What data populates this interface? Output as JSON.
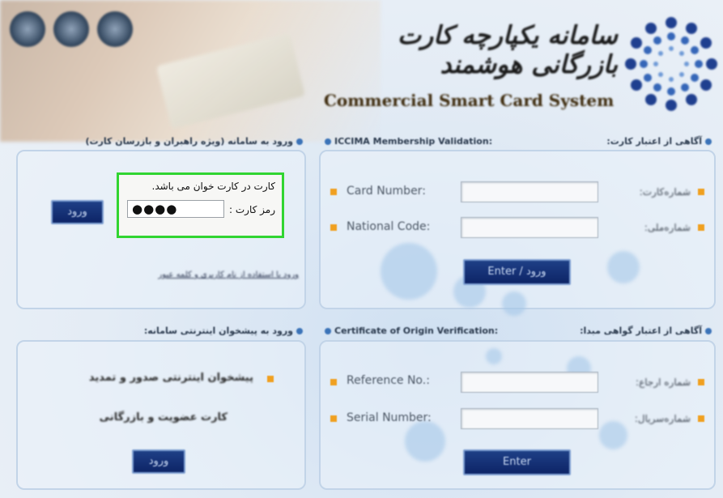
{
  "header": {
    "title_fa": "سامانه یکپارچه کارت بازرگانی هوشمند",
    "title_en": "Commercial Smart Card System",
    "seals": [
      "seal-1",
      "seal-2",
      "seal-3"
    ]
  },
  "left_top": {
    "heading": "ورود به سامانه (ویژه راهبران و بازرسان کارت)",
    "pin_dialog": {
      "message": "کارت در کارت خوان می باشد.",
      "label": "رمز کارت :",
      "value": "●●●●"
    },
    "login_button": "ورود",
    "link": "ورود با استفاده از نام کاربری و کلمه عبور"
  },
  "left_bottom": {
    "heading": "ورود به پیشخوان اینترنتی سامانه:",
    "desc_line1": "پیشخوان اینترنتی صدور و تمدید",
    "desc_line2": "کارت عضویت و بازرگانی",
    "button": "ورود"
  },
  "membership": {
    "heading_en": "ICCIMA Membership Validation:",
    "heading_fa": "آگاهی از اعتبار کارت:",
    "rows": [
      {
        "label": "Card Number:",
        "label_fa": "شماره‌کارت:"
      },
      {
        "label": "National Code:",
        "label_fa": "شماره‌ملی:"
      }
    ],
    "button": "Enter / ورود"
  },
  "origin": {
    "heading_en": "Certificate of Origin Verification:",
    "heading_fa": "آگاهی از اعتبار گواهی مبدا:",
    "rows": [
      {
        "label": "Reference No.:",
        "label_fa": "شماره ارجاع:"
      },
      {
        "label": "Serial Number:",
        "label_fa": "شماره‌سریال:"
      }
    ],
    "button": "Enter"
  },
  "colors": {
    "highlight": "#31d531",
    "button_bg": "#0d2466",
    "bullet": "#f0a020"
  }
}
